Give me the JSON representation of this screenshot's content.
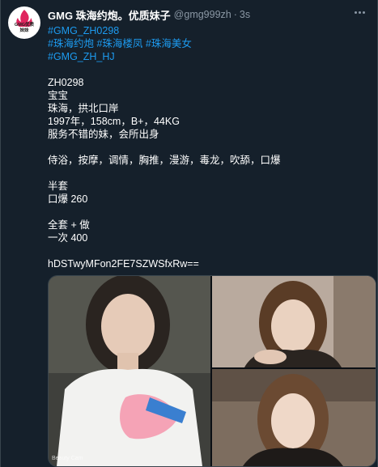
{
  "tweet": {
    "display_name": "GMG 珠海约炮。优质妹子",
    "handle": "@gmg999zh",
    "separator": "·",
    "time": "3s",
    "avatar_text": "GMG优质\n妹妹",
    "hashtags": {
      "line1": [
        "#GMG_ZH0298"
      ],
      "line2": [
        "#珠海约炮",
        "#珠海楼凤",
        "#珠海美女"
      ],
      "line3": [
        "#GMG_ZH_HJ"
      ]
    },
    "text_lines": {
      "code": "ZH0298",
      "name": "宝宝",
      "location": "珠海，拱北口岸",
      "stats": "1997年，158cm，B+，44KG",
      "desc": "服务不错的妹，会所出身",
      "services": "侍浴，按摩，调情，胸推，漫游，毒龙，吹舔，口爆",
      "half_title": "半套",
      "half_price": "口爆 260",
      "full_title": "全套 + 做",
      "full_price": "一次 400",
      "hash_code": "hDSTwyMFon2FE7SZWSfxRw=="
    },
    "media": {
      "watermark": "Beauty Cam"
    }
  },
  "colors": {
    "background": "#15202b",
    "link": "#1d9bf0",
    "muted": "#8b98a5",
    "border": "#38444d"
  }
}
